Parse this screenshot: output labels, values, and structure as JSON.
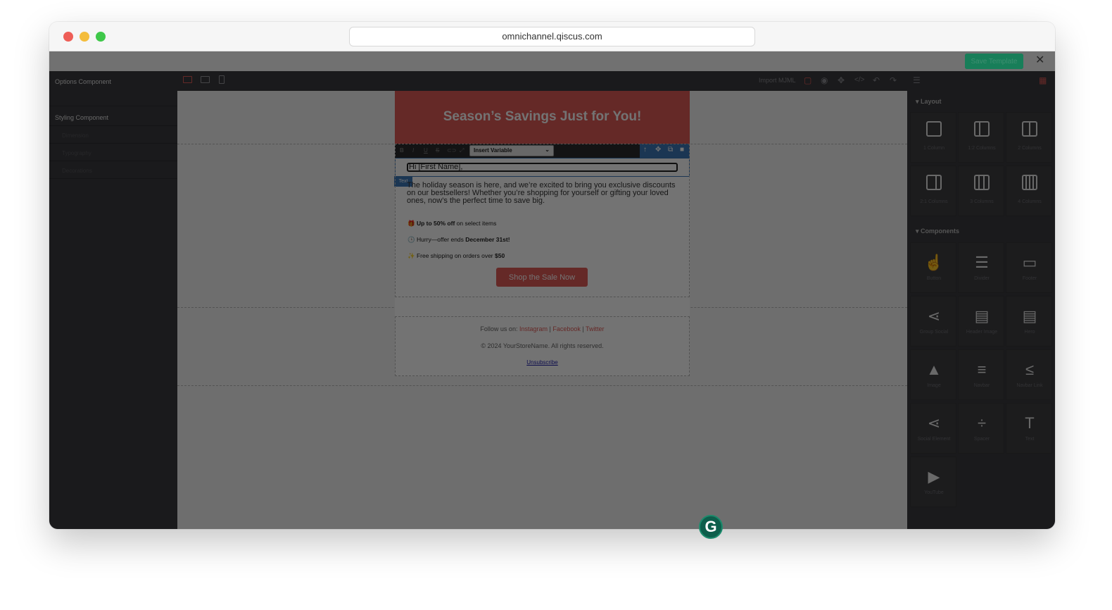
{
  "browser": {
    "url": "omnichannel.qiscus.com"
  },
  "topbar": {
    "save_label": "Save Template",
    "close_glyph": "✕"
  },
  "left_panel": {
    "options_title": "Options Component",
    "styling_title": "Styling Component",
    "styling_items": [
      "Dimension",
      "Typography",
      "Decorations"
    ]
  },
  "canvas_toolbar": {
    "import_label": "Import MJML"
  },
  "email": {
    "hero_title": "Season’s Savings Just for You!",
    "insert_variable": "Insert Variable",
    "first_name": "Hi [First Name],",
    "text_badge": "Text",
    "paragraph": "The holiday season is here, and we’re excited to bring you exclusive discounts on our bestsellers! Whether you’re shopping for yourself or gifting your loved ones, now’s the perfect time to save big.",
    "bullets": [
      {
        "icon": "🎁",
        "bold_pre": "Up to 50% off",
        "text": " on select items",
        "bold_post": ""
      },
      {
        "icon": "🕒",
        "bold_pre": "",
        "text": "Hurry—offer ends ",
        "bold_post": "December 31st!"
      },
      {
        "icon": "✨",
        "bold_pre": "",
        "text": "Free shipping on orders over ",
        "bold_post": "$50"
      }
    ],
    "cta": "Shop the Sale Now",
    "footer": {
      "follow_prefix": "Follow us on: ",
      "instagram": "Instagram",
      "sep1": " | ",
      "facebook": "Facebook",
      "sep2": " | ",
      "twitter": "Twitter",
      "copyright": "© 2024 YourStoreName. All rights reserved.",
      "unsubscribe": "Unsubscribe"
    }
  },
  "right_panel": {
    "layout_heading": "Layout",
    "layout_blocks": [
      "1 Column",
      "1:2 Columns",
      "2 Columns",
      "2:1 Columns",
      "3 Columns",
      "4 Columns"
    ],
    "components_heading": "Components",
    "component_blocks": [
      {
        "label": "Button",
        "icon": "button-icon",
        "glyph": "☝"
      },
      {
        "label": "Divider",
        "icon": "divider-icon",
        "glyph": "☰"
      },
      {
        "label": "Footer",
        "icon": "footer-icon",
        "glyph": "▭"
      },
      {
        "label": "Group Social",
        "icon": "share-icon",
        "glyph": "⋖"
      },
      {
        "label": "Header Image",
        "icon": "header-image-icon",
        "glyph": "▤"
      },
      {
        "label": "Hero",
        "icon": "hero-icon",
        "glyph": "▤"
      },
      {
        "label": "Image",
        "icon": "image-icon",
        "glyph": "▲"
      },
      {
        "label": "Navbar",
        "icon": "navbar-icon",
        "glyph": "≡"
      },
      {
        "label": "Navbar Link",
        "icon": "navbar-link-icon",
        "glyph": "≤"
      },
      {
        "label": "Social Element",
        "icon": "share-icon",
        "glyph": "⋖"
      },
      {
        "label": "Spacer",
        "icon": "spacer-icon",
        "glyph": "÷"
      },
      {
        "label": "Text",
        "icon": "text-icon",
        "glyph": "T"
      },
      {
        "label": "YouTube",
        "icon": "youtube-icon",
        "glyph": "▶"
      }
    ]
  },
  "colors": {
    "brand_red": "#e15b57",
    "save_green": "#1f9d6e",
    "selection_blue": "#3d79b9"
  }
}
